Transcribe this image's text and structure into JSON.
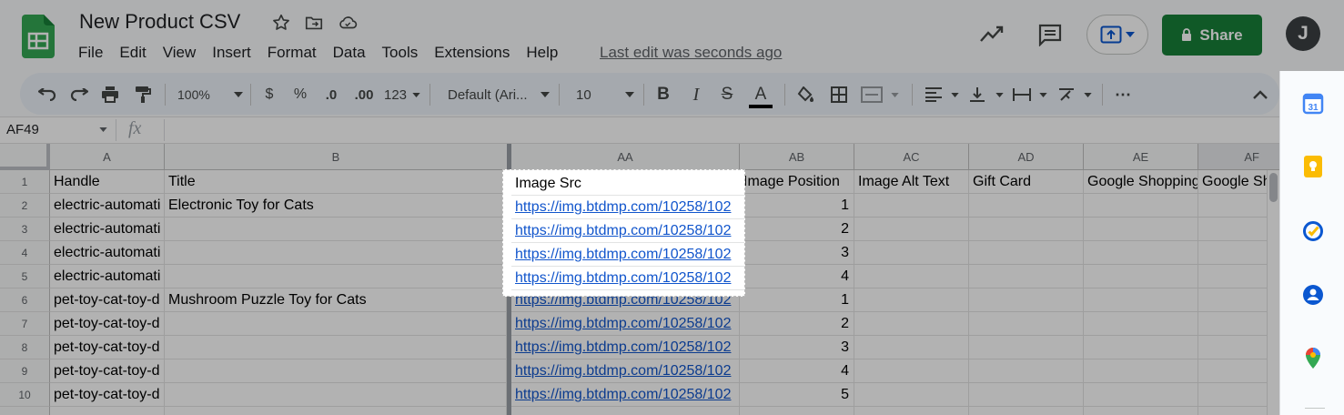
{
  "app": {
    "doc_title": "New Product CSV",
    "menu": [
      "File",
      "Edit",
      "View",
      "Insert",
      "Format",
      "Data",
      "Tools",
      "Extensions",
      "Help"
    ],
    "last_edit": "Last edit was seconds ago",
    "share_label": "Share",
    "avatar_initial": "J",
    "accent_color": "#188038"
  },
  "toolbar": {
    "zoom": "100%",
    "currency": "$",
    "percent": "%",
    "decrease_decimals": ".0",
    "increase_decimals": ".00",
    "format_more": "123",
    "font": "Default (Ari...",
    "font_size": "10",
    "bold": "B",
    "italic": "I",
    "strikethrough": "S",
    "text_color": "A",
    "more": "⋯"
  },
  "formula_bar": {
    "name_box": "AF49",
    "fx": "fx"
  },
  "grid": {
    "columns": [
      "A",
      "B",
      "AA",
      "AB",
      "AC",
      "AD",
      "AE",
      "AF"
    ],
    "row_numbers": [
      "1",
      "2",
      "3",
      "4",
      "5",
      "6",
      "7",
      "8",
      "9",
      "10"
    ],
    "header_row": [
      "Handle",
      "Title",
      "Image Src",
      "Image Position",
      "Image Alt Text",
      "Gift Card",
      "Google Shopping",
      "Google Sh"
    ],
    "rows": [
      {
        "a": "electric-automati",
        "b": "Electronic Toy for Cats",
        "aa": "https://img.btdmp.com/10258/102",
        "ab": "1"
      },
      {
        "a": "electric-automati",
        "b": "",
        "aa": "https://img.btdmp.com/10258/102",
        "ab": "2"
      },
      {
        "a": "electric-automati",
        "b": "",
        "aa": "https://img.btdmp.com/10258/102",
        "ab": "3"
      },
      {
        "a": "electric-automati",
        "b": "",
        "aa": "https://img.btdmp.com/10258/102",
        "ab": "4"
      },
      {
        "a": "pet-toy-cat-toy-d",
        "b": "Mushroom Puzzle Toy for Cats",
        "aa": "https://img.btdmp.com/10258/102",
        "ab": "1"
      },
      {
        "a": "pet-toy-cat-toy-d",
        "b": "",
        "aa": "https://img.btdmp.com/10258/102",
        "ab": "2"
      },
      {
        "a": "pet-toy-cat-toy-d",
        "b": "",
        "aa": "https://img.btdmp.com/10258/102",
        "ab": "3"
      },
      {
        "a": "pet-toy-cat-toy-d",
        "b": "",
        "aa": "https://img.btdmp.com/10258/102",
        "ab": "4"
      },
      {
        "a": "pet-toy-cat-toy-d",
        "b": "",
        "aa": "https://img.btdmp.com/10258/102",
        "ab": "5"
      }
    ]
  },
  "side_panel": [
    "calendar-icon",
    "keep-icon",
    "tasks-icon",
    "contacts-icon",
    "maps-icon"
  ]
}
